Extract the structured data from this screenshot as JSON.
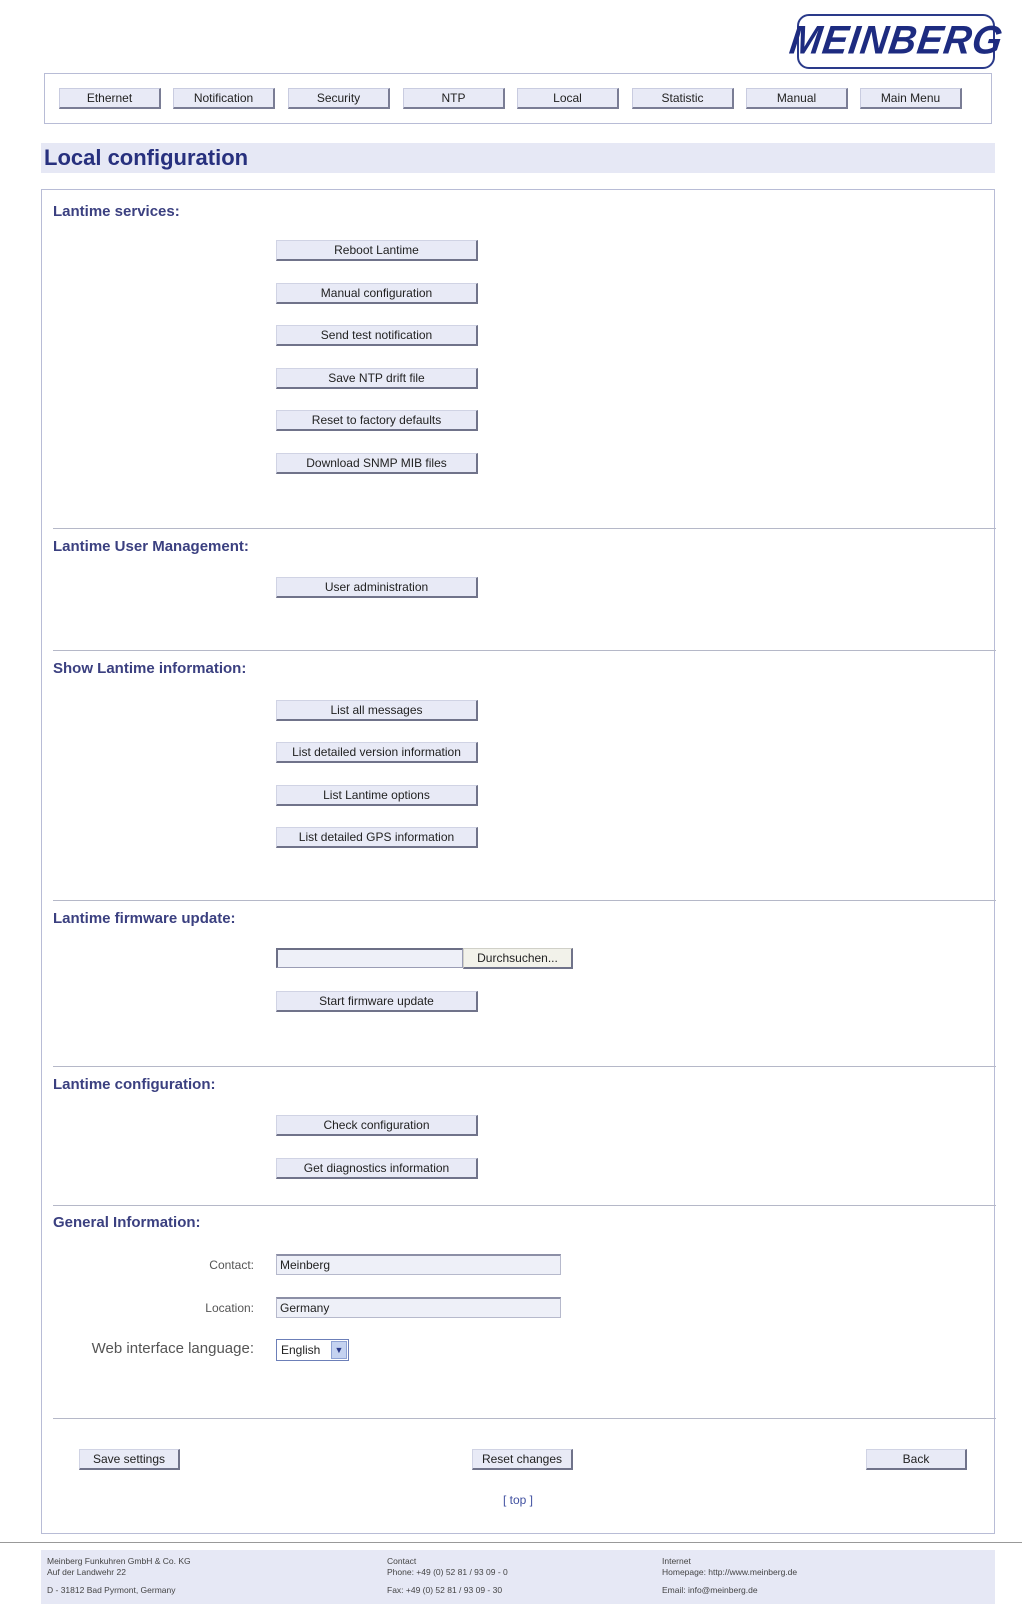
{
  "logo": {
    "text": "MEINBERG"
  },
  "nav": [
    "Ethernet",
    "Notification",
    "Security",
    "NTP",
    "Local",
    "Statistic",
    "Manual",
    "Main Menu"
  ],
  "page_title": "Local configuration",
  "sections": {
    "services": {
      "title": "Lantime services:",
      "buttons": [
        "Reboot Lantime",
        "Manual configuration",
        "Send test notification",
        "Save NTP drift file",
        "Reset to factory defaults",
        "Download SNMP MIB files"
      ]
    },
    "user_mgmt": {
      "title": "Lantime User Management:",
      "buttons": [
        "User administration"
      ]
    },
    "info": {
      "title": "Show Lantime information:",
      "buttons": [
        "List all messages",
        "List detailed version information",
        "List Lantime options",
        "List detailed GPS information"
      ]
    },
    "firmware": {
      "title": "Lantime firmware update:",
      "browse_label": "Durchsuchen...",
      "file_value": "",
      "start_label": "Start firmware update"
    },
    "config": {
      "title": "Lantime configuration:",
      "buttons": [
        "Check configuration",
        "Get diagnostics information"
      ]
    },
    "general": {
      "title": "General Information:",
      "contact_label": "Contact:",
      "contact_value": "Meinberg",
      "location_label": "Location:",
      "location_value": "Germany",
      "language_label": "Web interface language:",
      "language_value": "English"
    }
  },
  "actions": {
    "save": "Save settings",
    "reset": "Reset changes",
    "back": "Back",
    "top": "[ top ]"
  },
  "footer": {
    "company": [
      "Meinberg Funkuhren GmbH & Co. KG",
      "Auf der Landwehr 22",
      "D - 31812 Bad Pyrmont, Germany"
    ],
    "contact": [
      "Contact",
      "Phone: +49 (0) 52 81 / 93 09 - 0",
      "Fax: +49 (0) 52 81 / 93 09 - 30"
    ],
    "internet": [
      "Internet",
      "Homepage: http://www.meinberg.de",
      "Email: info@meinberg.de"
    ]
  },
  "colors": {
    "accent": "#27307e",
    "panel": "#e6e8f5",
    "button": "#e8eaf6"
  }
}
